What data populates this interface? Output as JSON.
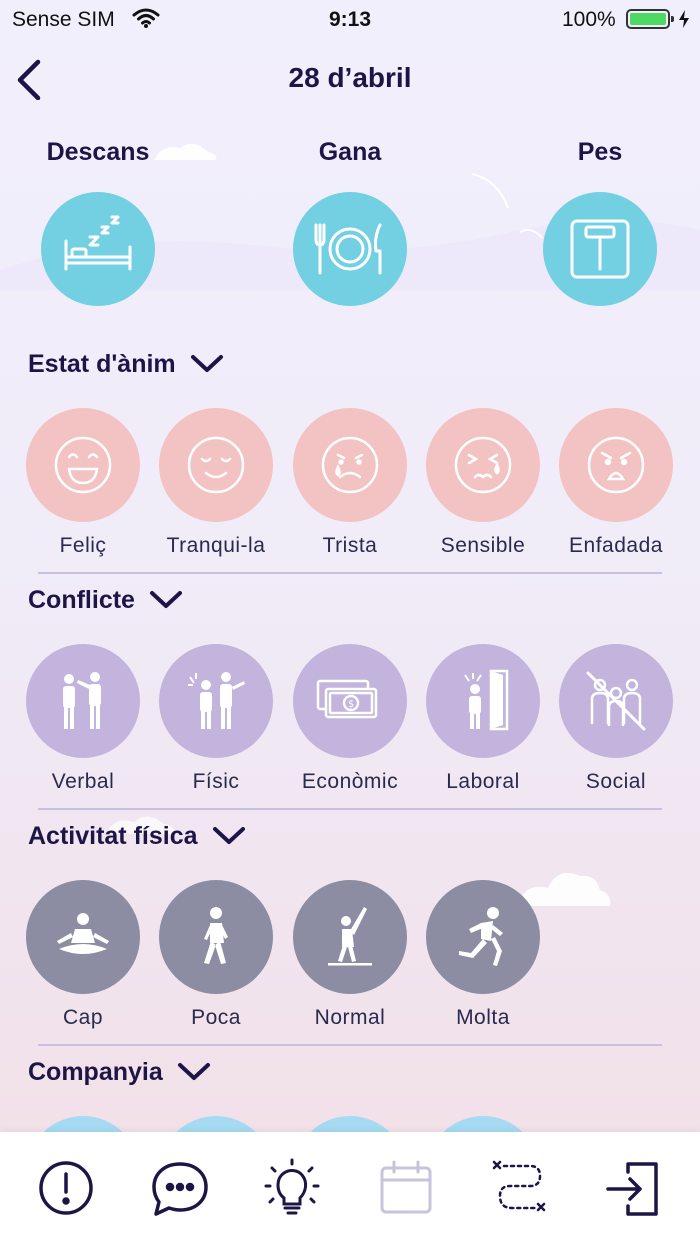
{
  "status_bar": {
    "carrier": "Sense SIM",
    "time": "9:13",
    "battery": "100%"
  },
  "header": {
    "title": "28 d’abril"
  },
  "top_items": [
    {
      "label": "Descans",
      "icon": "bed-icon"
    },
    {
      "label": "Gana",
      "icon": "plate-icon"
    },
    {
      "label": "Pes",
      "icon": "scale-icon"
    }
  ],
  "sections": {
    "mood": {
      "title": "Estat d'ànim",
      "items": [
        {
          "label": "Feliç",
          "icon": "happy-face-icon"
        },
        {
          "label": "Tranqui-la",
          "icon": "calm-face-icon"
        },
        {
          "label": "Trista",
          "icon": "sad-face-icon"
        },
        {
          "label": "Sensible",
          "icon": "sensitive-face-icon"
        },
        {
          "label": "Enfadada",
          "icon": "angry-face-icon"
        }
      ]
    },
    "conflict": {
      "title": "Conflicte",
      "items": [
        {
          "label": "Verbal",
          "icon": "verbal-conflict-icon"
        },
        {
          "label": "Físic",
          "icon": "physical-conflict-icon"
        },
        {
          "label": "Econòmic",
          "icon": "money-icon"
        },
        {
          "label": "Laboral",
          "icon": "work-door-icon"
        },
        {
          "label": "Social",
          "icon": "social-isolation-icon"
        }
      ]
    },
    "activity": {
      "title": "Activitat física",
      "items": [
        {
          "label": "Cap",
          "icon": "meditation-icon"
        },
        {
          "label": "Poca",
          "icon": "walking-icon"
        },
        {
          "label": "Normal",
          "icon": "stretching-icon"
        },
        {
          "label": "Molta",
          "icon": "running-icon"
        }
      ]
    },
    "company": {
      "title": "Companyia"
    }
  },
  "colors": {
    "teal": "#72d0e2",
    "pink": "#f3c3c3",
    "lilac": "#c2b4dc",
    "slate": "#8c8ca2",
    "navy": "#1e1547"
  },
  "tab_bar": [
    {
      "name": "alert-icon"
    },
    {
      "name": "chat-icon"
    },
    {
      "name": "lightbulb-icon"
    },
    {
      "name": "calendar-icon",
      "state": "disabled"
    },
    {
      "name": "route-icon"
    },
    {
      "name": "logout-icon"
    }
  ]
}
